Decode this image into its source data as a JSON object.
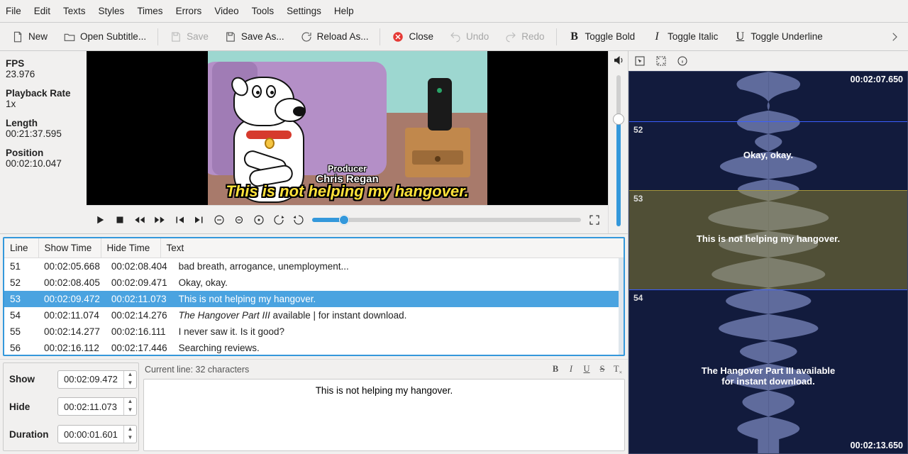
{
  "menus": [
    "File",
    "Edit",
    "Texts",
    "Styles",
    "Times",
    "Errors",
    "Video",
    "Tools",
    "Settings",
    "Help"
  ],
  "toolbar": {
    "new": "New",
    "open": "Open Subtitle...",
    "save": "Save",
    "save_as": "Save As...",
    "reload": "Reload As...",
    "close": "Close",
    "undo": "Undo",
    "redo": "Redo",
    "bold": "Toggle Bold",
    "italic": "Toggle Italic",
    "underline": "Toggle Underline"
  },
  "info": {
    "fps_l": "FPS",
    "fps": "23.976",
    "rate_l": "Playback Rate",
    "rate": "1x",
    "len_l": "Length",
    "len": "00:21:37.595",
    "pos_l": "Position",
    "pos": "00:02:10.047"
  },
  "overlay": {
    "credit_role": "Producer",
    "credit_name": "Chris Regan",
    "subtitle": "This is not helping my hangover."
  },
  "grid": {
    "headers": {
      "line": "Line",
      "show": "Show Time",
      "hide": "Hide Time",
      "text": "Text"
    },
    "rows": [
      {
        "n": "51",
        "show": "00:02:05.668",
        "hide": "00:02:08.404",
        "text": "bad breath, arrogance, unemployment..."
      },
      {
        "n": "52",
        "show": "00:02:08.405",
        "hide": "00:02:09.471",
        "text": "Okay, okay."
      },
      {
        "n": "53",
        "show": "00:02:09.472",
        "hide": "00:02:11.073",
        "text": "This is not helping my hangover.",
        "sel": true
      },
      {
        "n": "54",
        "show": "00:02:11.074",
        "hide": "00:02:14.276",
        "text_html": true,
        "p1": "The Hangover Part III",
        "p2": " available | for instant download."
      },
      {
        "n": "55",
        "show": "00:02:14.277",
        "hide": "00:02:16.111",
        "text": "I never saw it. Is it good?"
      },
      {
        "n": "56",
        "show": "00:02:16.112",
        "hide": "00:02:17.446",
        "text": "Searching reviews."
      }
    ]
  },
  "edit": {
    "show_l": "Show",
    "show": "00:02:09.472",
    "hide_l": "Hide",
    "hide": "00:02:11.073",
    "dur_l": "Duration",
    "dur": "00:00:01.601",
    "status": "Current line: 32 characters",
    "text": "This is not helping my hangover."
  },
  "wave": {
    "top": "00:02:07.650",
    "bot": "00:02:13.650",
    "segs": [
      {
        "n": "52",
        "text": "Okay, okay.",
        "top_pct": 13,
        "h_pct": 18
      },
      {
        "n": "53",
        "text": "This is not helping my hangover.",
        "top_pct": 31,
        "h_pct": 26,
        "sel": true
      },
      {
        "n": "54",
        "text": "The Hangover Part III available\nfor instant download.",
        "top_pct": 57,
        "h_pct": 43
      }
    ]
  }
}
